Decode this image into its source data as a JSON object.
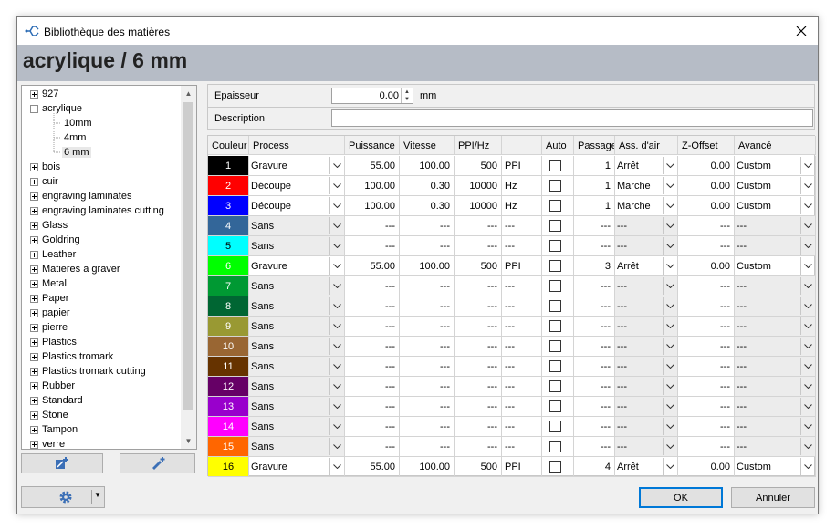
{
  "window": {
    "title": "Bibliothèque des matières"
  },
  "header": {
    "title": "acrylique / 6 mm"
  },
  "tree": [
    {
      "label": "927",
      "level": 0,
      "expand": "plus"
    },
    {
      "label": "acrylique",
      "level": 0,
      "expand": "minus"
    },
    {
      "label": "10mm",
      "level": 1
    },
    {
      "label": "4mm",
      "level": 1
    },
    {
      "label": "6 mm",
      "level": 1,
      "selected": true
    },
    {
      "label": "bois",
      "level": 0,
      "expand": "plus"
    },
    {
      "label": "cuir",
      "level": 0,
      "expand": "plus"
    },
    {
      "label": "engraving laminates",
      "level": 0,
      "expand": "plus"
    },
    {
      "label": "engraving laminates cutting",
      "level": 0,
      "expand": "plus"
    },
    {
      "label": "Glass",
      "level": 0,
      "expand": "plus"
    },
    {
      "label": "Goldring",
      "level": 0,
      "expand": "plus"
    },
    {
      "label": "Leather",
      "level": 0,
      "expand": "plus"
    },
    {
      "label": "Matieres a graver",
      "level": 0,
      "expand": "plus"
    },
    {
      "label": "Metal",
      "level": 0,
      "expand": "plus"
    },
    {
      "label": "Paper",
      "level": 0,
      "expand": "plus"
    },
    {
      "label": "papier",
      "level": 0,
      "expand": "plus"
    },
    {
      "label": "pierre",
      "level": 0,
      "expand": "plus"
    },
    {
      "label": "Plastics",
      "level": 0,
      "expand": "plus"
    },
    {
      "label": "Plastics tromark",
      "level": 0,
      "expand": "plus"
    },
    {
      "label": "Plastics tromark cutting",
      "level": 0,
      "expand": "plus"
    },
    {
      "label": "Rubber",
      "level": 0,
      "expand": "plus"
    },
    {
      "label": "Standard",
      "level": 0,
      "expand": "plus"
    },
    {
      "label": "Stone",
      "level": 0,
      "expand": "plus"
    },
    {
      "label": "Tampon",
      "level": 0,
      "expand": "plus"
    },
    {
      "label": "verre",
      "level": 0,
      "expand": "plus"
    }
  ],
  "props": {
    "thickness_label": "Epaisseur",
    "thickness_value": "0.00",
    "thickness_unit": "mm",
    "description_label": "Description",
    "description_value": ""
  },
  "columns": [
    "Couleur",
    "Process",
    "Puissance",
    "Vitesse",
    "PPI/Hz",
    "",
    "Auto",
    "Passage",
    "Ass. d'air",
    "Z-Offset",
    "Avancé"
  ],
  "rows": [
    {
      "n": "1",
      "color": "#000000",
      "fg": "#ffffff",
      "process": "Gravure",
      "power": "55.00",
      "speed": "100.00",
      "ppi": "500",
      "unit": "PPI",
      "passes": "1",
      "air": "Arrêt",
      "z": "0.00",
      "adv": "Custom",
      "active": true
    },
    {
      "n": "2",
      "color": "#ff0000",
      "fg": "#ffffff",
      "process": "Découpe",
      "power": "100.00",
      "speed": "0.30",
      "ppi": "10000",
      "unit": "Hz",
      "passes": "1",
      "air": "Marche",
      "z": "0.00",
      "adv": "Custom",
      "active": true
    },
    {
      "n": "3",
      "color": "#0000ff",
      "fg": "#ffffff",
      "process": "Découpe",
      "power": "100.00",
      "speed": "0.30",
      "ppi": "10000",
      "unit": "Hz",
      "passes": "1",
      "air": "Marche",
      "z": "0.00",
      "adv": "Custom",
      "active": true
    },
    {
      "n": "4",
      "color": "#336699",
      "fg": "#ffffff",
      "process": "Sans",
      "power": "---",
      "speed": "---",
      "ppi": "---",
      "unit": "---",
      "passes": "---",
      "air": "---",
      "z": "---",
      "adv": "---",
      "active": false
    },
    {
      "n": "5",
      "color": "#00ffff",
      "fg": "#000000",
      "process": "Sans",
      "power": "---",
      "speed": "---",
      "ppi": "---",
      "unit": "---",
      "passes": "---",
      "air": "---",
      "z": "---",
      "adv": "---",
      "active": false
    },
    {
      "n": "6",
      "color": "#00ff00",
      "fg": "#ffffff",
      "process": "Gravure",
      "power": "55.00",
      "speed": "100.00",
      "ppi": "500",
      "unit": "PPI",
      "passes": "3",
      "air": "Arrêt",
      "z": "0.00",
      "adv": "Custom",
      "active": true
    },
    {
      "n": "7",
      "color": "#009933",
      "fg": "#ffffff",
      "process": "Sans",
      "power": "---",
      "speed": "---",
      "ppi": "---",
      "unit": "---",
      "passes": "---",
      "air": "---",
      "z": "---",
      "adv": "---",
      "active": false
    },
    {
      "n": "8",
      "color": "#006633",
      "fg": "#ffffff",
      "process": "Sans",
      "power": "---",
      "speed": "---",
      "ppi": "---",
      "unit": "---",
      "passes": "---",
      "air": "---",
      "z": "---",
      "adv": "---",
      "active": false
    },
    {
      "n": "9",
      "color": "#999933",
      "fg": "#ffffff",
      "process": "Sans",
      "power": "---",
      "speed": "---",
      "ppi": "---",
      "unit": "---",
      "passes": "---",
      "air": "---",
      "z": "---",
      "adv": "---",
      "active": false
    },
    {
      "n": "10",
      "color": "#996633",
      "fg": "#ffffff",
      "process": "Sans",
      "power": "---",
      "speed": "---",
      "ppi": "---",
      "unit": "---",
      "passes": "---",
      "air": "---",
      "z": "---",
      "adv": "---",
      "active": false
    },
    {
      "n": "11",
      "color": "#663300",
      "fg": "#ffffff",
      "process": "Sans",
      "power": "---",
      "speed": "---",
      "ppi": "---",
      "unit": "---",
      "passes": "---",
      "air": "---",
      "z": "---",
      "adv": "---",
      "active": false
    },
    {
      "n": "12",
      "color": "#660066",
      "fg": "#ffffff",
      "process": "Sans",
      "power": "---",
      "speed": "---",
      "ppi": "---",
      "unit": "---",
      "passes": "---",
      "air": "---",
      "z": "---",
      "adv": "---",
      "active": false
    },
    {
      "n": "13",
      "color": "#9900cc",
      "fg": "#ffffff",
      "process": "Sans",
      "power": "---",
      "speed": "---",
      "ppi": "---",
      "unit": "---",
      "passes": "---",
      "air": "---",
      "z": "---",
      "adv": "---",
      "active": false
    },
    {
      "n": "14",
      "color": "#ff00ff",
      "fg": "#ffffff",
      "process": "Sans",
      "power": "---",
      "speed": "---",
      "ppi": "---",
      "unit": "---",
      "passes": "---",
      "air": "---",
      "z": "---",
      "adv": "---",
      "active": false
    },
    {
      "n": "15",
      "color": "#ff6600",
      "fg": "#ffffff",
      "process": "Sans",
      "power": "---",
      "speed": "---",
      "ppi": "---",
      "unit": "---",
      "passes": "---",
      "air": "---",
      "z": "---",
      "adv": "---",
      "active": false
    },
    {
      "n": "16",
      "color": "#ffff00",
      "fg": "#000000",
      "process": "Gravure",
      "power": "55.00",
      "speed": "100.00",
      "ppi": "500",
      "unit": "PPI",
      "passes": "4",
      "air": "Arrêt",
      "z": "0.00",
      "adv": "Custom",
      "active": true
    }
  ],
  "buttons": {
    "ok": "OK",
    "cancel": "Annuler"
  },
  "icons": {
    "add_material": "add-material-icon",
    "add_thickness": "add-thickness-icon",
    "settings": "gear-icon"
  }
}
